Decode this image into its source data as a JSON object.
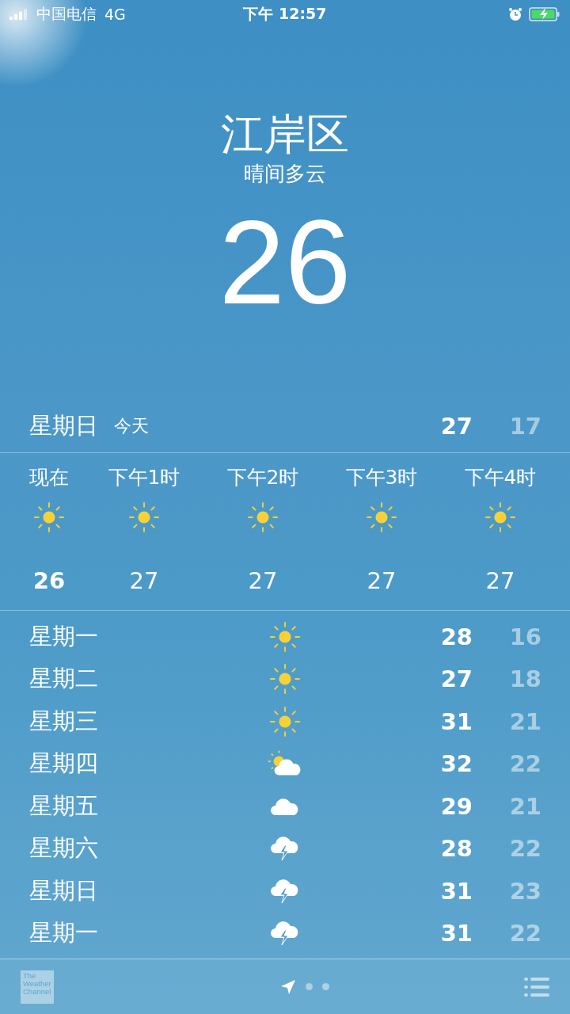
{
  "status_bar": {
    "carrier": "中国电信",
    "network": "4G",
    "time": "下午 12:57",
    "charging": true
  },
  "location": {
    "city": "江岸区",
    "condition": "晴间多云",
    "temperature": "26"
  },
  "today": {
    "day": "星期日",
    "label": "今天",
    "high": "27",
    "low": "17"
  },
  "hourly": [
    {
      "time": "现在",
      "kind": "sun",
      "temp": "26",
      "current": true
    },
    {
      "time": "下午1时",
      "kind": "sun",
      "temp": "27",
      "current": false
    },
    {
      "time": "下午2时",
      "kind": "sun",
      "temp": "27",
      "current": false
    },
    {
      "time": "下午3时",
      "kind": "sun",
      "temp": "27",
      "current": false
    },
    {
      "time": "下午4时",
      "kind": "sun",
      "temp": "27",
      "current": false
    }
  ],
  "daily": [
    {
      "day": "星期一",
      "kind": "sun",
      "high": "28",
      "low": "16"
    },
    {
      "day": "星期二",
      "kind": "sun",
      "high": "27",
      "low": "18"
    },
    {
      "day": "星期三",
      "kind": "sun",
      "high": "31",
      "low": "21"
    },
    {
      "day": "星期四",
      "kind": "partly",
      "high": "32",
      "low": "22"
    },
    {
      "day": "星期五",
      "kind": "cloud",
      "high": "29",
      "low": "21"
    },
    {
      "day": "星期六",
      "kind": "storm",
      "high": "28",
      "low": "22"
    },
    {
      "day": "星期日",
      "kind": "storm",
      "high": "31",
      "low": "23"
    },
    {
      "day": "星期一",
      "kind": "storm",
      "high": "31",
      "low": "22"
    }
  ],
  "bottom_bar": {
    "logo": "The Weather Channel",
    "pages": [
      {
        "kind": "location",
        "selected": true
      },
      {
        "kind": "dot",
        "selected": false
      },
      {
        "kind": "dot",
        "selected": false
      }
    ]
  }
}
